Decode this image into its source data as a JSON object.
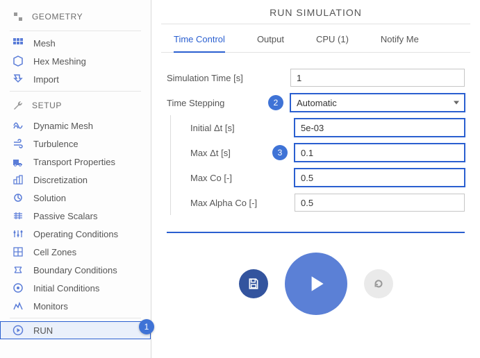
{
  "sidebar": {
    "sections": [
      {
        "heading": "GEOMETRY",
        "items": []
      },
      {
        "heading": null,
        "items": [
          {
            "label": "Mesh",
            "icon": "mesh"
          },
          {
            "label": "Hex Meshing",
            "icon": "hex"
          },
          {
            "label": "Import",
            "icon": "import"
          }
        ]
      },
      {
        "heading": "SETUP",
        "items": [
          {
            "label": "Dynamic Mesh",
            "icon": "dynmesh"
          },
          {
            "label": "Turbulence",
            "icon": "turb"
          },
          {
            "label": "Transport Properties",
            "icon": "transport"
          },
          {
            "label": "Discretization",
            "icon": "disc"
          },
          {
            "label": "Solution",
            "icon": "solution"
          },
          {
            "label": "Passive Scalars",
            "icon": "scalars"
          },
          {
            "label": "Operating Conditions",
            "icon": "opcond"
          },
          {
            "label": "Cell Zones",
            "icon": "cellzones"
          },
          {
            "label": "Boundary Conditions",
            "icon": "bc"
          },
          {
            "label": "Initial Conditions",
            "icon": "ic"
          },
          {
            "label": "Monitors",
            "icon": "monitors"
          }
        ]
      },
      {
        "heading": null,
        "items": [
          {
            "label": "RUN",
            "icon": "run",
            "selected": true
          }
        ]
      }
    ]
  },
  "markers": {
    "m1": "1",
    "m2": "2",
    "m3": "3"
  },
  "main": {
    "title": "RUN SIMULATION",
    "tabs": [
      {
        "label": "Time Control",
        "active": true
      },
      {
        "label": "Output"
      },
      {
        "label": "CPU  (1)"
      },
      {
        "label": "Notify Me"
      }
    ],
    "fields": {
      "simTime": {
        "label": "Simulation Time [s]",
        "value": "1"
      },
      "timeStep": {
        "label": "Time Stepping",
        "value": "Automatic"
      },
      "initDt": {
        "label": "Initial Δt [s]",
        "value": "5e-03"
      },
      "maxDt": {
        "label": "Max Δt [s]",
        "value": "0.1"
      },
      "maxCo": {
        "label": "Max Co [-]",
        "value": "0.5"
      },
      "maxAlphaCo": {
        "label": "Max Alpha Co [-]",
        "value": "0.5"
      }
    }
  }
}
